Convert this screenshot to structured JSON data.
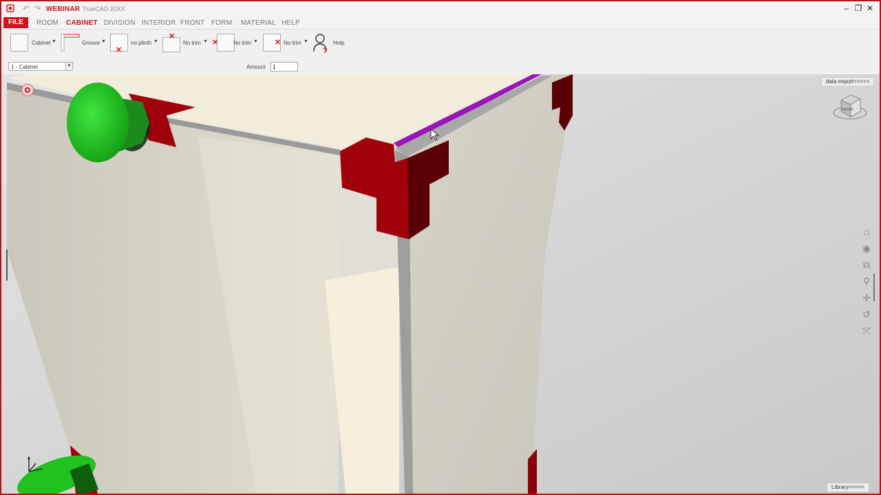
{
  "title_bar": {
    "brand": "WEBINAR",
    "app_title": "TrueCAD 20XX",
    "minimize": "–",
    "restore": "❐",
    "close": "✕"
  },
  "menu": {
    "file": "FILE",
    "items": [
      "ROOM",
      "CABINET",
      "DIVISION",
      "INTERIOR",
      "FRONT",
      "FORM",
      "MATERIAL",
      "HELP"
    ],
    "active": "CABINET"
  },
  "ribbon": {
    "cabinet": "Cabinet",
    "groove": "Groove",
    "plinth": "no plinth",
    "trim1": "No trim",
    "trim2": "No trim",
    "trim3": "No trim",
    "help": "Help"
  },
  "row2": {
    "cabinet_select": "1 - Cabinet",
    "amount_label": "Amount",
    "amount_value": "1"
  },
  "viewport": {
    "data_export": "data export<<<<<",
    "library": "Library<<<<<",
    "viewcube_label": "FRONT"
  },
  "colors": {
    "accent": "#d1141c",
    "connector": "#8b0000",
    "edge_highlight": "#9b16b8",
    "marker": "#1fc21f",
    "panel": "#f2ecdd"
  },
  "icons": [
    "home-icon",
    "orbit-icon",
    "zoom-window-icon",
    "zoom-icon",
    "pan-icon",
    "rotate-icon",
    "fit-icon"
  ]
}
